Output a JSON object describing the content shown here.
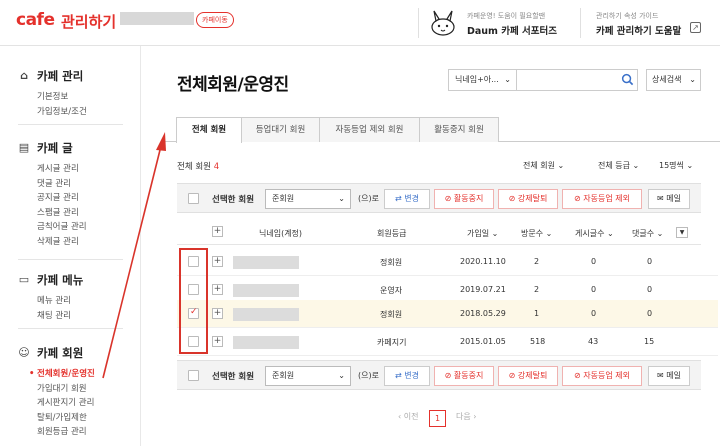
{
  "header": {
    "logo": "cafe",
    "logo_sub": "관리하기",
    "cafe_move": "카페이동",
    "supporters_small": "카페운영! 도움이 필요할땐",
    "supporters_big": "Daum 카페 서포터즈",
    "guide_small": "관리하기 속성 가이드",
    "guide_big": "카페 관리하기 도움말"
  },
  "sidebar": {
    "sections": [
      {
        "title": "카페 관리",
        "icon": "house-icon",
        "items": [
          "기본정보",
          "가입정보/조건"
        ]
      },
      {
        "title": "카페 글",
        "icon": "document-icon",
        "items": [
          "게시글 관리",
          "댓글 관리",
          "공지글 관리",
          "스팸글 관리",
          "금칙어글 관리",
          "삭제글 관리"
        ]
      },
      {
        "title": "카페 메뉴",
        "icon": "menu-icon",
        "items": [
          "메뉴 관리",
          "채팅 관리"
        ]
      },
      {
        "title": "카페 회원",
        "icon": "member-icon",
        "items": [
          "전체회원/운영진",
          "가입대기 회원",
          "게시판지기 관리",
          "탈퇴/가입제한",
          "회원등급 관리"
        ]
      }
    ]
  },
  "main": {
    "title": "전체회원/운영진",
    "search_select": "닉네임+아...",
    "search_value": "",
    "detail_search": "상세검색",
    "tabs": [
      "전체 회원",
      "등업대기 회원",
      "자동등업 제외 회원",
      "활동중지 회원"
    ],
    "total_label": "전체 회원",
    "total_count": "4",
    "filters": [
      "전체 회원",
      "전체 등급",
      "15명씩"
    ],
    "action": {
      "label": "선택한 회원",
      "grade": "준회원",
      "suffix": "(으)로",
      "change": "변경",
      "suspend": "활동중지",
      "expel": "강제탈퇴",
      "auto_exclude": "자동등업 제외",
      "mail": "메일"
    },
    "columns": [
      "닉네임(계정)",
      "회원등급",
      "가입일",
      "방문수",
      "게시글수",
      "댓글수"
    ],
    "rows": [
      {
        "grade": "정회원",
        "joined": "2020.11.10",
        "visits": "2",
        "posts": "0",
        "comments": "0",
        "checked": false
      },
      {
        "grade": "운영자",
        "joined": "2019.07.21",
        "visits": "2",
        "posts": "0",
        "comments": "0",
        "checked": false
      },
      {
        "grade": "정회원",
        "joined": "2018.05.29",
        "visits": "1",
        "posts": "0",
        "comments": "0",
        "checked": true
      },
      {
        "grade": "카페지기",
        "joined": "2015.01.05",
        "visits": "518",
        "posts": "43",
        "comments": "15",
        "checked": false
      }
    ],
    "pager": {
      "prev": "이전",
      "current": "1",
      "next": "다음"
    }
  },
  "colors": {
    "brand": "#e4312c",
    "blue": "#3a70c9",
    "highlight": "#fdf8e7"
  }
}
